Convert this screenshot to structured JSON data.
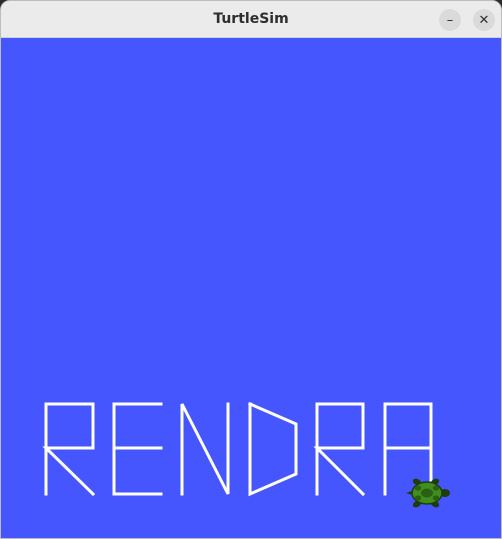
{
  "window": {
    "title": "TurtleSim",
    "minimize_symbol": "–",
    "close_symbol": "✕"
  },
  "canvas": {
    "background_color": "#4556ff",
    "pen_color": "#ffffff",
    "drawn_text": "RENDRA",
    "turtle_icon": "turtle-icon",
    "turtle_colors": {
      "shell": "#3f8f1f",
      "shell_dark": "#2c5e14",
      "body": "#1f3d0c"
    }
  }
}
